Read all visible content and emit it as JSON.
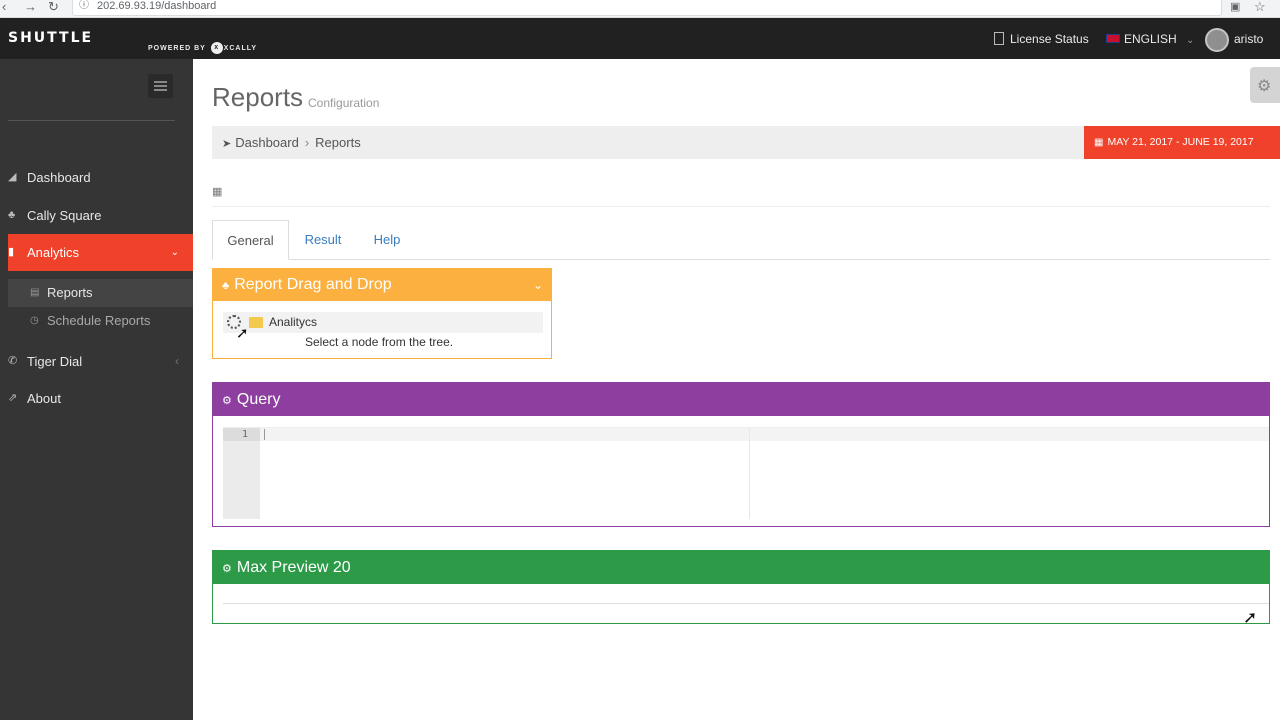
{
  "browser": {
    "url": "202.69.93.19/dashboard",
    "back_icon": "arrow-right-icon",
    "reload_icon": "reload-icon"
  },
  "header": {
    "logo": "SHUTTLE",
    "powered_by": "POWERED BY",
    "powered_brand": "XCALLY",
    "license_status": "License Status",
    "language": "ENGLISH",
    "username": "aristo"
  },
  "sidebar": {
    "items": [
      {
        "label": "Dashboard",
        "icon": "dashboard-icon"
      },
      {
        "label": "Cally Square",
        "icon": "sitemap-icon"
      },
      {
        "label": "Analytics",
        "icon": "bar-chart-icon"
      },
      {
        "label": "Tiger Dial",
        "icon": "phone-icon"
      },
      {
        "label": "About",
        "icon": "external-link-icon"
      }
    ],
    "subitems": [
      {
        "label": "Reports",
        "icon": "table-icon"
      },
      {
        "label": "Schedule Reports",
        "icon": "clock-icon"
      }
    ]
  },
  "page": {
    "title": "Reports",
    "subtitle": "Configuration"
  },
  "breadcrumb": {
    "home": "Dashboard",
    "current": "Reports"
  },
  "date_range": "MAY 21, 2017 - JUNE 19, 2017",
  "tabs": [
    "General",
    "Result",
    "Help"
  ],
  "panels": {
    "drag": {
      "title": "Report Drag and Drop",
      "tree_node": "Analitycs",
      "hint": "Select a node from the tree.",
      "color": "#fbb040"
    },
    "query": {
      "title": "Query",
      "line_number": "1",
      "color": "#8e3e9e"
    },
    "preview": {
      "title": "Max Preview 20",
      "color": "#2c9a47"
    }
  },
  "colors": {
    "accent": "#f0412b",
    "sidebar_bg": "#353535",
    "header_bg": "#212121"
  }
}
